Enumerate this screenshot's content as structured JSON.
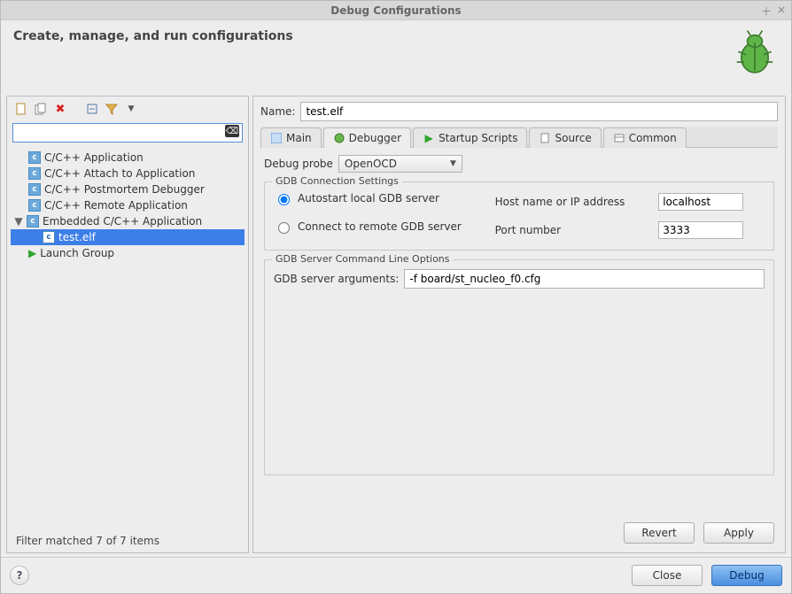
{
  "window": {
    "title": "Debug Configurations"
  },
  "header": {
    "title": "Create, manage, and run configurations"
  },
  "left": {
    "filter_value": "",
    "items": [
      {
        "label": "C/C++ Application"
      },
      {
        "label": "C/C++ Attach to Application"
      },
      {
        "label": "C/C++ Postmortem Debugger"
      },
      {
        "label": "C/C++ Remote Application"
      },
      {
        "label": "Embedded C/C++ Application"
      },
      {
        "label": "test.elf"
      },
      {
        "label": "Launch Group"
      }
    ],
    "status": "Filter matched 7 of 7 items"
  },
  "right": {
    "name_label": "Name:",
    "name_value": "test.elf",
    "tabs": [
      {
        "label": "Main"
      },
      {
        "label": "Debugger"
      },
      {
        "label": "Startup Scripts"
      },
      {
        "label": "Source"
      },
      {
        "label": "Common"
      }
    ],
    "probe_label": "Debug probe",
    "probe_value": "OpenOCD",
    "conn_legend": "GDB Connection Settings",
    "radio_autostart": "Autostart local GDB server",
    "radio_remote": "Connect to remote GDB server",
    "host_label": "Host name or IP address",
    "host_value": "localhost",
    "port_label": "Port number",
    "port_value": "3333",
    "srv_legend": "GDB Server Command Line Options",
    "args_label": "GDB server arguments:",
    "args_value": "-f board/st_nucleo_f0.cfg",
    "btn_revert": "Revert",
    "btn_apply": "Apply"
  },
  "footer": {
    "btn_close": "Close",
    "btn_debug": "Debug"
  }
}
